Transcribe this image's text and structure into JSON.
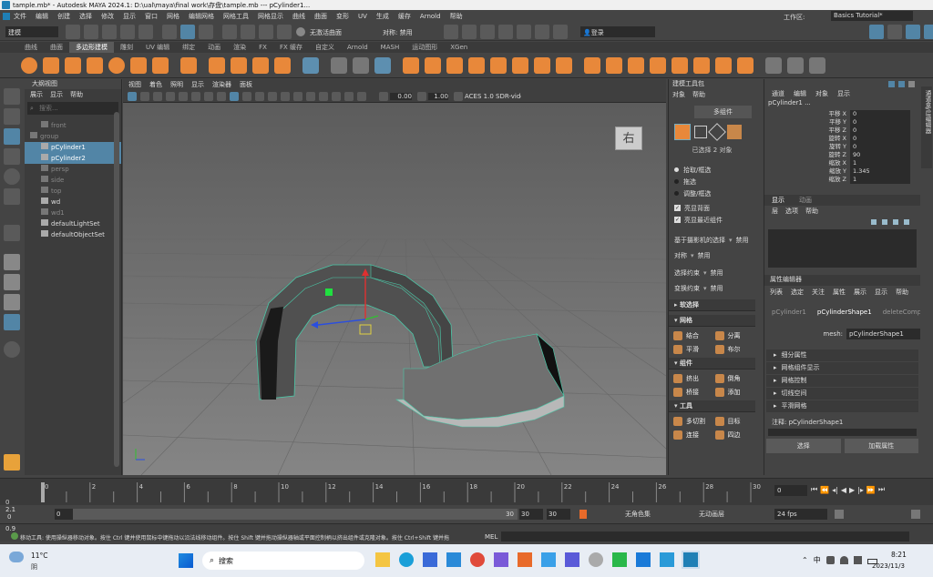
{
  "window": {
    "title": "tample.mb* - Autodesk MAYA 2024.1: D:\\ual\\maya\\final work\\存盘\\tample.mb --- pCylinder1..."
  },
  "menubar": {
    "items": [
      "文件",
      "编辑",
      "创建",
      "选择",
      "修改",
      "显示",
      "窗口",
      "网格",
      "编辑网格",
      "网格工具",
      "网格显示",
      "曲线",
      "曲面",
      "变形",
      "UV",
      "生成",
      "缓存",
      "Arnold",
      "帮助"
    ],
    "workspace_label": "工作区:",
    "workspace_value": "Basics Tutorial*"
  },
  "statusline": {
    "mode": "建模",
    "live_surface": "无激活曲面",
    "symmetry": "对称: 禁用",
    "login": "登录"
  },
  "shelf": {
    "tabs": [
      "曲线",
      "曲面",
      "多边形建模",
      "雕刻",
      "UV 编辑",
      "绑定",
      "动画",
      "渲染",
      "FX",
      "FX 缓存",
      "自定义",
      "Arnold",
      "MASH",
      "运动图形",
      "XGen"
    ],
    "active": "多边形建模"
  },
  "outliner": {
    "title": "大纲视图",
    "menu": [
      "展示",
      "显示",
      "帮助"
    ],
    "search_placeholder": "搜索...",
    "items": [
      {
        "label": "front",
        "dim": true,
        "indent": 1
      },
      {
        "label": "group",
        "dim": true,
        "indent": 0
      },
      {
        "label": "pCylinder1",
        "dim": false,
        "indent": 1,
        "selected": true
      },
      {
        "label": "pCylinder2",
        "dim": false,
        "indent": 1,
        "selected": true
      },
      {
        "label": "persp",
        "dim": true,
        "indent": 1
      },
      {
        "label": "side",
        "dim": true,
        "indent": 1
      },
      {
        "label": "top",
        "dim": true,
        "indent": 1
      },
      {
        "label": "wd",
        "dim": false,
        "indent": 1
      },
      {
        "label": "wd1",
        "dim": true,
        "indent": 1
      },
      {
        "label": "defaultLightSet",
        "dim": false,
        "indent": 1
      },
      {
        "label": "defaultObjectSet",
        "dim": false,
        "indent": 1
      }
    ]
  },
  "viewport": {
    "menu": [
      "视图",
      "着色",
      "照明",
      "显示",
      "渲染器",
      "面板"
    ],
    "exposure": "0.00",
    "gamma": "1.00",
    "colorspace": "ACES 1.0 SDR-vide",
    "viewcube_label": "右"
  },
  "modeling_toolkit": {
    "title": "建模工具包",
    "menu": [
      "对象",
      "帮助"
    ],
    "component_mode": "多组件",
    "selected_info": "已选择 2 对象",
    "pick_options": [
      "拾取/框选",
      "拖选",
      "调整/框选"
    ],
    "checkboxes": [
      "亮显背面",
      "亮显最近组件"
    ],
    "camera_select": "基于摄影机的选择",
    "camera_select_value": "禁用",
    "symmetry": "对称",
    "symmetry_value": "禁用",
    "select_constraint": "选择约束",
    "select_constraint_value": "禁用",
    "transform_constraint": "变换约束",
    "transform_constraint_value": "禁用",
    "soft_select": "软选择",
    "sections": {
      "mesh": "网格",
      "component": "组件",
      "tools": "工具"
    },
    "mesh_buttons": [
      "结合",
      "分离",
      "平滑",
      "布尔"
    ],
    "component_buttons": [
      "挤出",
      "倒角",
      "桥接",
      "添加"
    ],
    "tool_buttons": [
      "多切割",
      "目标",
      "连接",
      "四边"
    ]
  },
  "channelbox": {
    "menu": [
      "通道",
      "编辑",
      "对象",
      "显示"
    ],
    "object": "pCylinder1 ...",
    "channels": [
      {
        "name": "平移 X",
        "value": "0"
      },
      {
        "name": "平移 Y",
        "value": "0"
      },
      {
        "name": "平移 Z",
        "value": "0"
      },
      {
        "name": "旋转 X",
        "value": "0"
      },
      {
        "name": "旋转 Y",
        "value": "0"
      },
      {
        "name": "旋转 Z",
        "value": "90"
      },
      {
        "name": "缩放 X",
        "value": "1"
      },
      {
        "name": "缩放 Y",
        "value": "1.345"
      },
      {
        "name": "缩放 Z",
        "value": "1"
      }
    ],
    "layer_tabs": [
      "显示",
      "动画"
    ],
    "layer_menu": [
      "层",
      "选项",
      "帮助"
    ]
  },
  "attribute_editor": {
    "title": "属性编辑器",
    "menu": [
      "列表",
      "选定",
      "关注",
      "属性",
      "展示",
      "显示",
      "帮助"
    ],
    "tabs": [
      "pCylinder1",
      "pCylinderShape1",
      "deleteComp"
    ],
    "mesh_label": "mesh:",
    "mesh_value": "pCylinderShape1",
    "sections": [
      "细分属性",
      "网格组件显示",
      "网格控制",
      "切线空间",
      "平滑网格"
    ],
    "notes_label": "注释: pCylinderShape1",
    "select_button": "选择",
    "load_button": "加载属性"
  },
  "side_tab": "通道盒/层编辑器",
  "timeline": {
    "ticks": [
      "0",
      "2",
      "4",
      "6",
      "8",
      "10",
      "12",
      "14",
      "16",
      "18",
      "20",
      "22",
      "24",
      "26",
      "28",
      "30"
    ],
    "current": "0"
  },
  "range": {
    "start": "0",
    "inner_start": "0",
    "inner_end": "30",
    "end": "30",
    "end2": "30",
    "char_set": "无角色集",
    "anim_layer": "无动画层",
    "fps": "24 fps"
  },
  "side_numbers": [
    "2.1",
    "0",
    "0.9"
  ],
  "mel": {
    "label": "MEL"
  },
  "help_line": "移动工具: 使用操纵器移动对象。按住 Ctrl 键并使用鼠标中键拖动以沿法线移动组件。按住 Shift 键并拖动操纵器轴或平面控制柄以挤出组件或克隆对象。按住 Ctrl+Shift 键并拖",
  "taskbar": {
    "weather_temp": "11°C",
    "weather_text": "阴",
    "search": "搜索",
    "time": "8:21",
    "date": "2023/11/3",
    "ime": "中"
  }
}
